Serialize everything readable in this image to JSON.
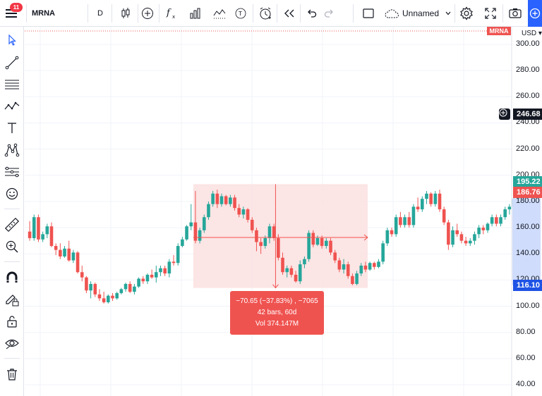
{
  "toolbar": {
    "notification_count": "11",
    "symbol": "MRNA",
    "interval": "D",
    "layout_name": "Unnamed",
    "icons": [
      "menu-icon",
      "candles-icon",
      "add-compare-icon",
      "indicators-icon",
      "templates-icon",
      "multi-chart-icon",
      "text-t-icon",
      "alert-icon",
      "replay-icon",
      "undo-icon",
      "redo-icon",
      "fullscreen-square-icon",
      "cloud-icon",
      "chevron-down-icon",
      "settings-gear-icon",
      "fullscreen-icon",
      "camera-icon",
      "plus-icon"
    ]
  },
  "left_tools": [
    "cursor-icon",
    "trend-line-icon",
    "horizontal-lines-icon",
    "pattern-icon",
    "text-icon",
    "node-pattern-icon",
    "measure-prediction-icon",
    "emoji-icon",
    "ruler-icon",
    "zoom-in-icon",
    "magnet-icon",
    "lock-drawing-icon",
    "lock-icon",
    "eye-icon",
    "trash-icon"
  ],
  "price_scale": {
    "currency": "USD",
    "ticks": [
      "300.00",
      "280.00",
      "260.00",
      "240.00",
      "220.00",
      "200.00",
      "180.00",
      "160.00",
      "140.00",
      "120.00",
      "100.00",
      "80.00",
      "60.00",
      "40.00"
    ],
    "tags": {
      "symbol": "MRNA",
      "crosshair": "246.68",
      "teal": "195.22",
      "last": "186.76",
      "measure_low": "116.10"
    }
  },
  "measure": {
    "line1": "−70.65 (−37.83%) , −7065",
    "line2": "42 bars, 60d",
    "line3": "Vol 374.147M"
  },
  "colors": {
    "up": "#26a69a",
    "down": "#ef5350",
    "accent": "#2962ff",
    "measure_fill": "#fce0e0"
  },
  "chart_data": {
    "type": "candlestick",
    "ylim": [
      40,
      310
    ],
    "candles": [
      [
        157,
        165,
        150,
        152
      ],
      [
        152,
        170,
        150,
        168
      ],
      [
        168,
        170,
        149,
        151
      ],
      [
        151,
        157,
        149,
        155
      ],
      [
        155,
        163,
        152,
        161
      ],
      [
        161,
        164,
        145,
        146
      ],
      [
        146,
        148,
        139,
        143
      ],
      [
        143,
        148,
        136,
        138
      ],
      [
        138,
        146,
        137,
        144
      ],
      [
        144,
        150,
        134,
        135
      ],
      [
        135,
        143,
        133,
        141
      ],
      [
        141,
        142,
        125,
        126
      ],
      [
        126,
        131,
        119,
        122
      ],
      [
        122,
        123,
        110,
        112
      ],
      [
        112,
        119,
        106,
        117
      ],
      [
        117,
        118,
        107,
        109
      ],
      [
        109,
        113,
        104,
        106
      ],
      [
        106,
        111,
        102,
        103
      ],
      [
        103,
        109,
        102,
        108
      ],
      [
        108,
        110,
        104,
        106
      ],
      [
        106,
        111,
        105,
        110
      ],
      [
        110,
        114,
        109,
        113
      ],
      [
        113,
        118,
        111,
        117
      ],
      [
        117,
        119,
        110,
        111
      ],
      [
        111,
        117,
        109,
        115
      ],
      [
        115,
        122,
        114,
        121
      ],
      [
        121,
        123,
        117,
        119
      ],
      [
        119,
        125,
        117,
        124
      ],
      [
        124,
        128,
        121,
        122
      ],
      [
        122,
        131,
        118,
        126
      ],
      [
        126,
        131,
        123,
        129
      ],
      [
        129,
        131,
        123,
        125
      ],
      [
        125,
        136,
        122,
        134
      ],
      [
        134,
        139,
        131,
        133
      ],
      [
        133,
        148,
        131,
        146
      ],
      [
        146,
        153,
        145,
        151
      ],
      [
        151,
        162,
        150,
        161
      ],
      [
        161,
        178,
        158,
        164
      ],
      [
        164,
        188,
        148,
        150
      ],
      [
        150,
        160,
        148,
        158
      ],
      [
        158,
        170,
        156,
        168
      ],
      [
        168,
        180,
        166,
        178
      ],
      [
        178,
        188,
        176,
        186
      ],
      [
        186,
        189,
        175,
        178
      ],
      [
        178,
        186,
        176,
        184
      ],
      [
        184,
        185,
        177,
        178
      ],
      [
        178,
        185,
        176,
        183
      ],
      [
        183,
        185,
        173,
        175
      ],
      [
        175,
        178,
        168,
        170
      ],
      [
        170,
        176,
        167,
        174
      ],
      [
        174,
        175,
        164,
        166
      ],
      [
        166,
        168,
        156,
        158
      ],
      [
        158,
        160,
        142,
        149
      ],
      [
        149,
        152,
        140,
        146
      ],
      [
        146,
        154,
        144,
        152
      ],
      [
        152,
        163,
        148,
        161
      ],
      [
        161,
        163,
        150,
        152
      ],
      [
        152,
        155,
        135,
        137
      ],
      [
        137,
        141,
        124,
        126
      ],
      [
        126,
        131,
        122,
        129
      ],
      [
        129,
        131,
        122,
        124
      ],
      [
        124,
        127,
        118,
        119
      ],
      [
        119,
        135,
        117,
        132
      ],
      [
        132,
        138,
        129,
        136
      ],
      [
        136,
        158,
        134,
        156
      ],
      [
        156,
        158,
        145,
        147
      ],
      [
        147,
        154,
        146,
        152
      ],
      [
        152,
        154,
        144,
        146
      ],
      [
        146,
        152,
        144,
        150
      ],
      [
        150,
        152,
        139,
        141
      ],
      [
        141,
        143,
        133,
        135
      ],
      [
        135,
        137,
        126,
        128
      ],
      [
        128,
        136,
        125,
        132
      ],
      [
        132,
        134,
        121,
        123
      ],
      [
        123,
        125,
        116,
        117
      ],
      [
        117,
        127,
        116,
        125
      ],
      [
        125,
        133,
        123,
        131
      ],
      [
        131,
        134,
        126,
        128
      ],
      [
        128,
        134,
        127,
        133
      ],
      [
        133,
        134,
        128,
        130
      ],
      [
        130,
        136,
        129,
        134
      ],
      [
        134,
        150,
        132,
        148
      ],
      [
        148,
        160,
        146,
        158
      ],
      [
        158,
        160,
        153,
        155
      ],
      [
        155,
        170,
        153,
        168
      ],
      [
        168,
        172,
        160,
        162
      ],
      [
        162,
        170,
        160,
        168
      ],
      [
        168,
        172,
        160,
        162
      ],
      [
        162,
        178,
        160,
        176
      ],
      [
        176,
        183,
        172,
        174
      ],
      [
        174,
        184,
        172,
        182
      ],
      [
        182,
        188,
        178,
        186
      ],
      [
        186,
        187,
        176,
        178
      ],
      [
        178,
        188,
        176,
        186
      ],
      [
        186,
        189,
        172,
        174
      ],
      [
        174,
        176,
        162,
        164
      ],
      [
        164,
        166,
        143,
        147
      ],
      [
        147,
        161,
        145,
        158
      ],
      [
        158,
        163,
        153,
        155
      ],
      [
        155,
        157,
        148,
        150
      ],
      [
        150,
        153,
        146,
        148
      ],
      [
        148,
        152,
        146,
        150
      ],
      [
        150,
        157,
        147,
        155
      ],
      [
        155,
        162,
        152,
        160
      ],
      [
        160,
        162,
        155,
        158
      ],
      [
        158,
        164,
        156,
        163
      ],
      [
        163,
        170,
        161,
        168
      ],
      [
        168,
        170,
        161,
        163
      ],
      [
        163,
        170,
        161,
        168
      ],
      [
        168,
        176,
        166,
        174
      ],
      [
        174,
        178,
        170,
        176
      ],
      [
        176,
        183,
        174,
        182
      ],
      [
        182,
        193,
        180,
        192
      ],
      [
        192,
        199,
        184,
        186
      ]
    ],
    "measure_from": 186.75,
    "measure_to": 116.1
  }
}
